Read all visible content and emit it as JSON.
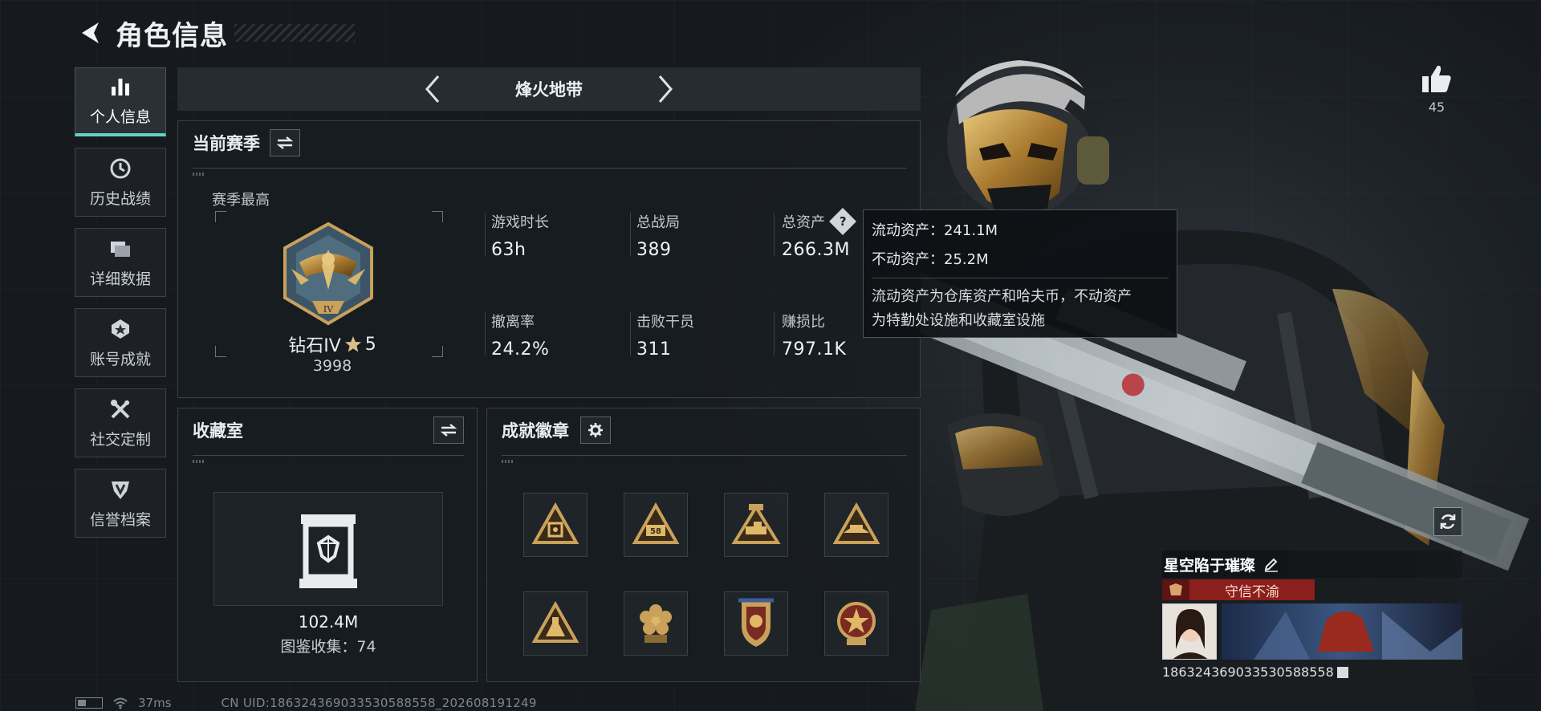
{
  "header": {
    "title": "角色信息"
  },
  "sidebar": {
    "items": [
      {
        "label": "个人信息",
        "icon": "bar-chart-icon",
        "active": true
      },
      {
        "label": "历史战绩",
        "icon": "clock-icon"
      },
      {
        "label": "详细数据",
        "icon": "folder-icon"
      },
      {
        "label": "账号成就",
        "icon": "medal-icon"
      },
      {
        "label": "社交定制",
        "icon": "tools-icon"
      },
      {
        "label": "信誉档案",
        "icon": "shield-icon"
      }
    ]
  },
  "mode": {
    "name": "烽火地带"
  },
  "season": {
    "title": "当前赛季",
    "subtitle": "赛季最高",
    "rank_name": "钻石IV",
    "rank_stars": "5",
    "rank_score": "3998",
    "stats": [
      {
        "label": "游戏时长",
        "value": "63h"
      },
      {
        "label": "总战局",
        "value": "389"
      },
      {
        "label": "总资产",
        "value": "266.3M",
        "help": true
      },
      {
        "label": "撤离率",
        "value": "24.2%"
      },
      {
        "label": "击败干员",
        "value": "311"
      },
      {
        "label": "赚损比",
        "value": "797.1K"
      }
    ]
  },
  "tooltip": {
    "liquid": "流动资产：241.1M",
    "fixed": "不动资产：25.2M",
    "note_line1": "流动资产为仓库资产和哈夫币，不动资产",
    "note_line2": "为特勤处设施和收藏室设施"
  },
  "collection": {
    "title": "收藏室",
    "value": "102.4M",
    "count": "图鉴收集：74"
  },
  "badges": {
    "title": "成就徽章",
    "items": [
      {
        "icon": "triangle-badge-icon"
      },
      {
        "icon": "triangle-badge-58-icon"
      },
      {
        "icon": "tank-badge-icon"
      },
      {
        "icon": "hat-badge-icon"
      },
      {
        "icon": "flask-badge-icon"
      },
      {
        "icon": "flower-badge-icon"
      },
      {
        "icon": "shield-badge-icon"
      },
      {
        "icon": "star-shield-badge-icon"
      }
    ]
  },
  "like": {
    "count": "45"
  },
  "player": {
    "name": "星空陷于璀璨",
    "tag": "守信不渝",
    "uid": "1863243690335305885​58",
    "uid_display": "1863243690335305885​58"
  },
  "status": {
    "ping": "37ms",
    "uid_line": "CN UID:186324369033530588558_202608191249"
  },
  "colors": {
    "accent": "#5fd3c5",
    "gold": "#c9a15a",
    "tag_red": "#8a1f1c"
  }
}
